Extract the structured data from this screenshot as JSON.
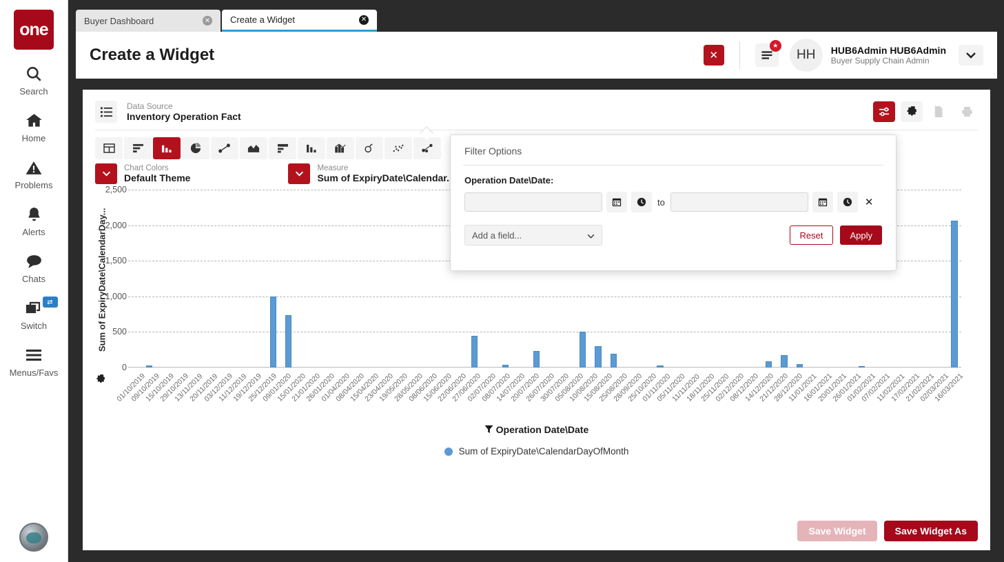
{
  "sidebar": {
    "logo_text": "one",
    "items": [
      {
        "label": "Search",
        "icon": "search-icon"
      },
      {
        "label": "Home",
        "icon": "home-icon"
      },
      {
        "label": "Problems",
        "icon": "warning-icon"
      },
      {
        "label": "Alerts",
        "icon": "bell-icon"
      },
      {
        "label": "Chats",
        "icon": "chat-icon"
      },
      {
        "label": "Switch",
        "icon": "switch-icon",
        "badge": "⇄"
      },
      {
        "label": "Menus/Favs",
        "icon": "hamburger-icon"
      }
    ]
  },
  "tabs": [
    {
      "label": "Buyer Dashboard",
      "active": false
    },
    {
      "label": "Create a Widget",
      "active": true
    }
  ],
  "header": {
    "title": "Create a Widget",
    "close_label": "✕",
    "notification_badge": "★",
    "avatar_initials": "HH",
    "user_name": "HUB6Admin HUB6Admin",
    "user_role": "Buyer Supply Chain Admin"
  },
  "datasource": {
    "label": "Data Source",
    "value": "Inventory Operation Fact"
  },
  "widget_tools": [
    {
      "name": "filter-options-button",
      "icon": "sliders-icon",
      "active": true,
      "disabled": false
    },
    {
      "name": "settings-button",
      "icon": "gear-icon",
      "active": false,
      "disabled": false
    },
    {
      "name": "export-button",
      "icon": "export-icon",
      "active": false,
      "disabled": true
    },
    {
      "name": "print-button",
      "icon": "printer-icon",
      "active": false,
      "disabled": true
    }
  ],
  "chart_types": [
    {
      "name": "table-chart",
      "icon": "table-icon",
      "selected": false
    },
    {
      "name": "horizontal-bar-chart",
      "icon": "hbar-icon",
      "selected": false
    },
    {
      "name": "column-chart",
      "icon": "column-icon",
      "selected": true
    },
    {
      "name": "pie-chart",
      "icon": "pie-icon",
      "selected": false
    },
    {
      "name": "line-chart",
      "icon": "line-icon",
      "selected": false
    },
    {
      "name": "area-chart",
      "icon": "area-icon",
      "selected": false
    },
    {
      "name": "stacked-bar-chart",
      "icon": "stacked-bar-icon",
      "selected": false
    },
    {
      "name": "grouped-column-chart",
      "icon": "grouped-column-icon",
      "selected": false
    },
    {
      "name": "combo-chart",
      "icon": "combo-icon",
      "selected": false
    },
    {
      "name": "donut-chart",
      "icon": "donut-icon",
      "selected": false
    },
    {
      "name": "scatter-chart",
      "icon": "scatter-icon",
      "selected": false
    },
    {
      "name": "bubble-chart",
      "icon": "bubble-icon",
      "selected": false
    },
    {
      "name": "clear-chart",
      "icon": "x-icon",
      "selected": false
    }
  ],
  "selectors": {
    "chart_colors_label": "Chart Colors",
    "chart_colors_value": "Default Theme",
    "measure_label": "Measure",
    "measure_value": "Sum of ExpiryDate\\Calendar..."
  },
  "filter_popup": {
    "title": "Filter Options",
    "field_label": "Operation Date\\Date:",
    "from_value": "",
    "to_separator": "to",
    "to_value": "",
    "calendar_icon": "calendar-icon",
    "clock_icon": "clock-icon",
    "clear_icon": "✕",
    "add_field_placeholder": "Add a field...",
    "reset_label": "Reset",
    "apply_label": "Apply"
  },
  "footer": {
    "save_widget_label": "Save Widget",
    "save_widget_as_label": "Save Widget As"
  },
  "chart_data": {
    "type": "bar",
    "title": "",
    "xlabel": "Operation Date\\Date",
    "ylabel": "Sum of ExpiryDate\\CalendarDay...",
    "ylim": [
      0,
      2500
    ],
    "yticks": [
      0,
      500,
      1000,
      1500,
      2000,
      2500
    ],
    "ytick_labels": [
      "0",
      "500",
      "1,000",
      "1,500",
      "2,000",
      "2,500"
    ],
    "grid": true,
    "legend_position": "bottom",
    "legend": [
      "Sum of ExpiryDate\\CalendarDayOfMonth"
    ],
    "series_color": "#5b9bd5",
    "categories": [
      "01/10/2019",
      "09/10/2019",
      "15/10/2019",
      "29/10/2019",
      "13/11/2019",
      "20/11/2019",
      "03/12/2019",
      "11/12/2019",
      "19/12/2019",
      "25/12/2019",
      "09/01/2020",
      "15/01/2020",
      "21/01/2020",
      "26/01/2020",
      "01/04/2020",
      "08/04/2020",
      "15/04/2020",
      "23/04/2020",
      "19/05/2020",
      "28/05/2020",
      "08/06/2020",
      "15/06/2020",
      "22/06/2020",
      "27/06/2020",
      "02/07/2020",
      "08/07/2020",
      "14/07/2020",
      "20/07/2020",
      "26/07/2020",
      "30/07/2020",
      "05/08/2020",
      "10/08/2020",
      "15/08/2020",
      "25/08/2020",
      "28/09/2020",
      "25/10/2020",
      "01/11/2020",
      "05/11/2020",
      "11/11/2020",
      "18/11/2020",
      "25/11/2020",
      "02/12/2020",
      "08/12/2020",
      "14/12/2020",
      "21/12/2020",
      "28/12/2020",
      "11/01/2021",
      "16/01/2021",
      "20/01/2021",
      "26/01/2021",
      "01/02/2021",
      "07/02/2021",
      "11/02/2021",
      "17/02/2021",
      "21/02/2021",
      "02/03/2021",
      "16/03/2021"
    ],
    "values": [
      0,
      0,
      0,
      30,
      0,
      0,
      0,
      0,
      0,
      0,
      0,
      1000,
      740,
      0,
      0,
      0,
      0,
      0,
      0,
      0,
      0,
      0,
      0,
      0,
      450,
      0,
      40,
      0,
      235,
      0,
      0,
      505,
      300,
      195,
      0,
      0,
      30,
      0,
      0,
      0,
      0,
      0,
      0,
      90,
      170,
      45,
      0,
      0,
      0,
      20,
      0,
      0,
      0,
      0,
      0,
      2060,
      0
    ],
    "series": [
      {
        "name": "Sum of ExpiryDate\\CalendarDayOfMonth",
        "values": [
          0,
          0,
          0,
          30,
          0,
          0,
          0,
          0,
          0,
          0,
          0,
          1000,
          740,
          0,
          0,
          0,
          0,
          0,
          0,
          0,
          0,
          0,
          0,
          0,
          450,
          0,
          40,
          0,
          235,
          0,
          0,
          505,
          300,
          195,
          0,
          0,
          30,
          0,
          0,
          0,
          0,
          0,
          0,
          90,
          170,
          45,
          0,
          0,
          0,
          20,
          0,
          0,
          0,
          0,
          0,
          2060,
          0
        ]
      }
    ]
  }
}
